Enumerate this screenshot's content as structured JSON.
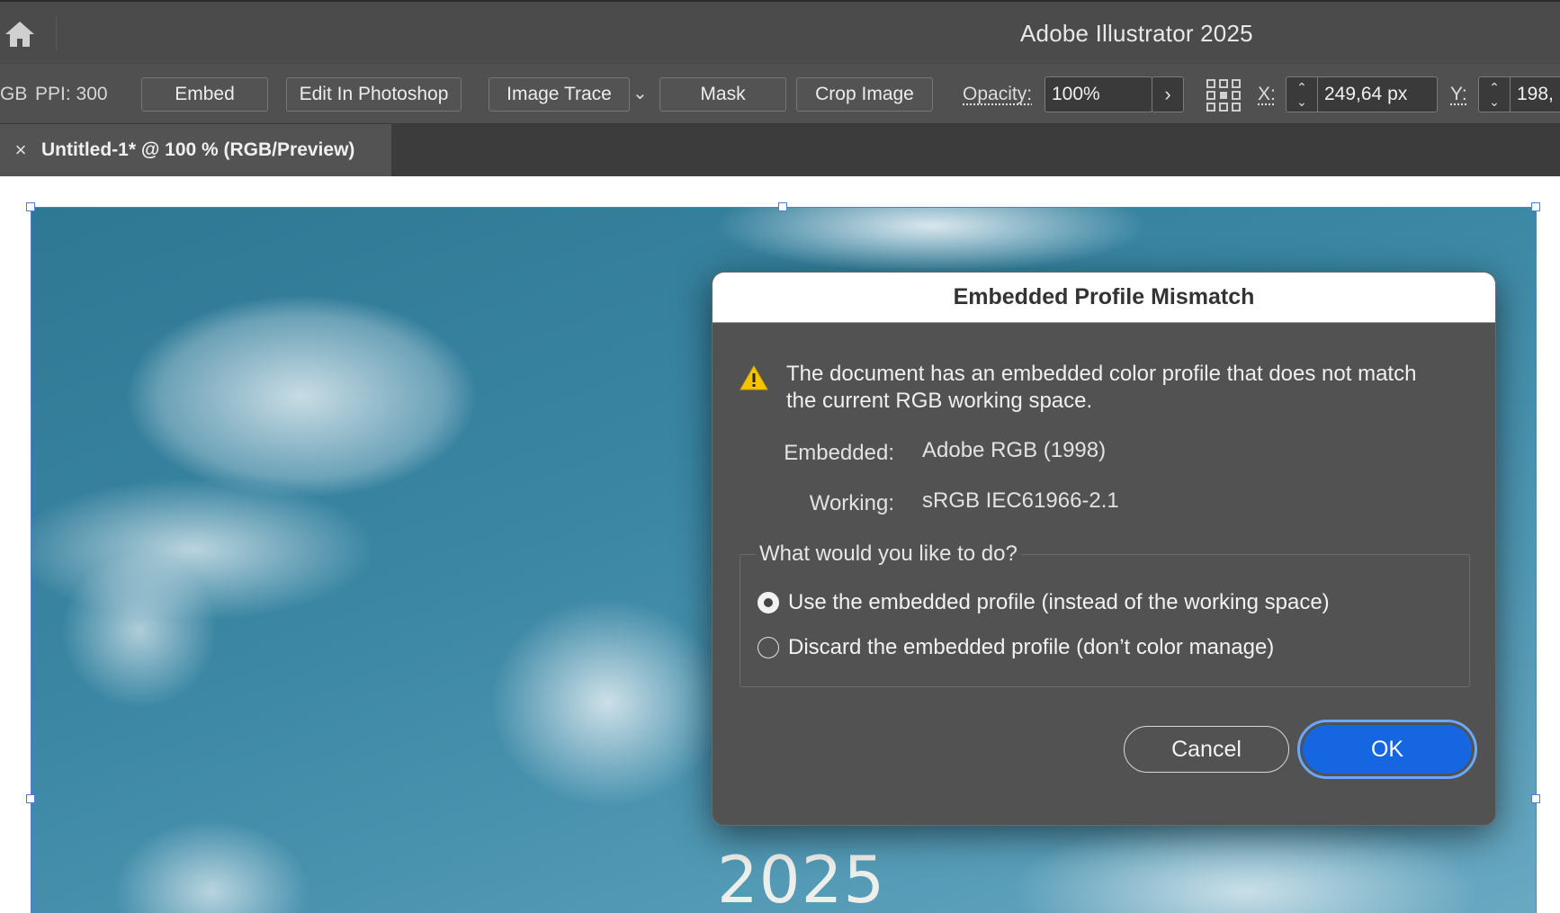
{
  "app": {
    "title": "Adobe Illustrator 2025",
    "home_icon": "home-icon"
  },
  "control_bar": {
    "color_mode_partial": "GB",
    "ppi": "PPI: 300",
    "buttons": {
      "embed": "Embed",
      "edit_in_photoshop": "Edit In Photoshop",
      "image_trace": "Image Trace",
      "mask": "Mask",
      "crop_image": "Crop Image"
    },
    "opacity_label": "Opacity:",
    "opacity_value": "100%",
    "x_label": "X:",
    "x_value": "249,64 px",
    "y_label": "Y:",
    "y_value": "198,"
  },
  "tab": {
    "close_glyph": "×",
    "label": "Untitled-1* @ 100 % (RGB/Preview)"
  },
  "artwork": {
    "year_text": "2025"
  },
  "dialog": {
    "title": "Embedded Profile Mismatch",
    "message": "The document has an embedded color profile that does not match the current RGB working space.",
    "embedded_label": "Embedded:",
    "embedded_value": "Adobe RGB (1998)",
    "working_label": "Working:",
    "working_value": "sRGB IEC61966-2.1",
    "question": "What would you like to do?",
    "options": [
      {
        "label": "Use the embedded profile (instead of the working space)",
        "selected": true
      },
      {
        "label": "Discard the embedded profile (don’t color manage)",
        "selected": false
      }
    ],
    "cancel_label": "Cancel",
    "ok_label": "OK"
  },
  "colors": {
    "accent": "#1566e0",
    "selection": "#4a7fe0",
    "chrome": "#505050"
  }
}
